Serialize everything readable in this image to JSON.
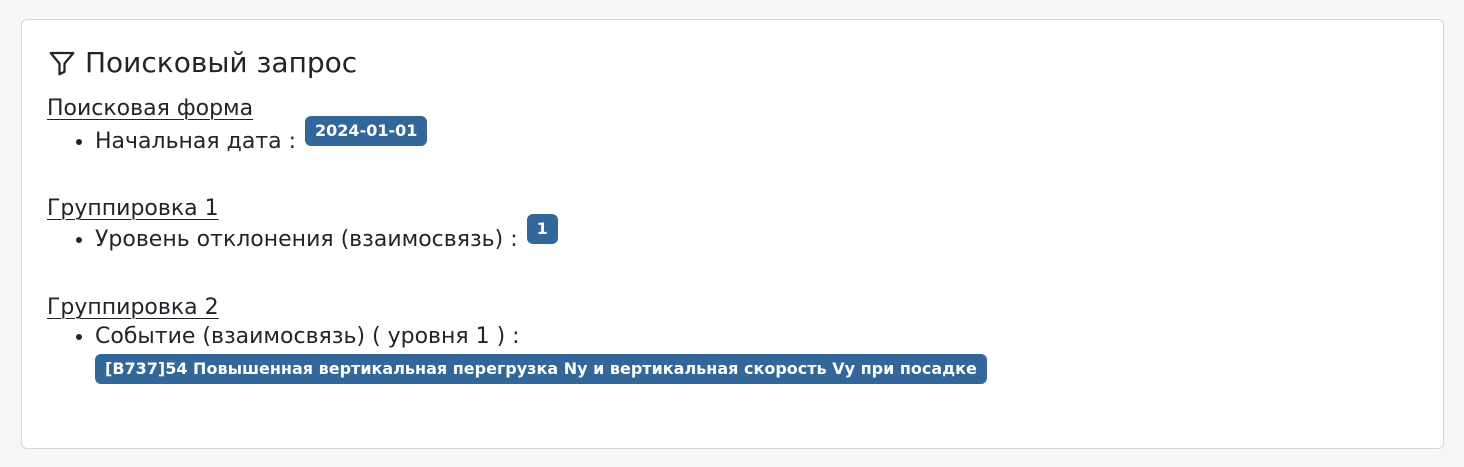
{
  "card": {
    "title": "Поисковый запрос",
    "title_icon": "filter-icon",
    "sections": [
      {
        "title": "Поисковая форма",
        "items": [
          {
            "label": "Начальная дата :",
            "badge": "2024-01-01"
          }
        ]
      },
      {
        "title": "Группировка 1",
        "items": [
          {
            "label": "Уровень отклонения (взаимосвязь) :",
            "badge": "1"
          }
        ]
      },
      {
        "title": "Группировка 2",
        "items": [
          {
            "label": "Событие (взаимосвязь) ( уровня 1 ) :",
            "badge": "[B737]54 Повышенная вертикальная перегрузка Ny и вертикальная скорость Vy при посадке"
          }
        ]
      }
    ]
  },
  "colors": {
    "badge_bg": "#336699",
    "badge_text": "#ffffff",
    "card_border": "#d3d6d9"
  }
}
